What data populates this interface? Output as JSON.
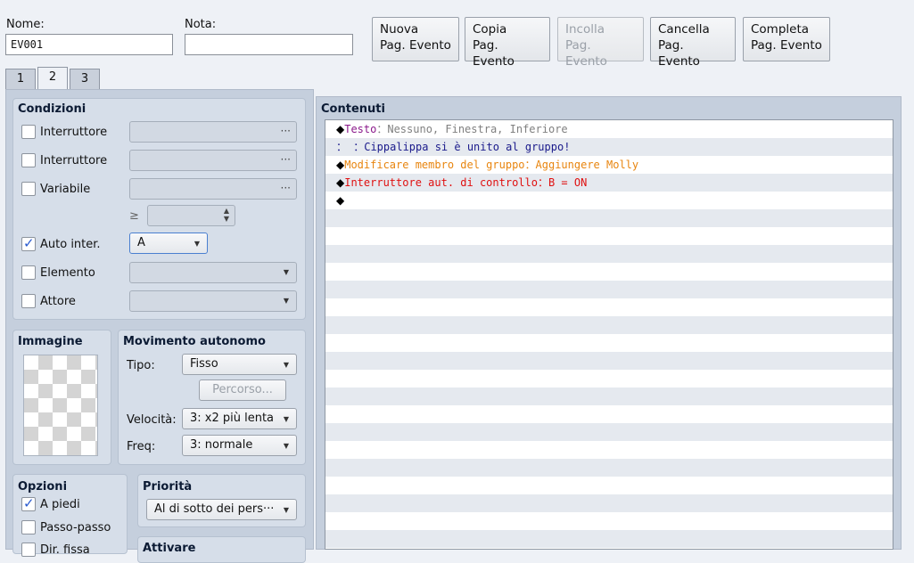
{
  "header": {
    "name_label": "Nome:",
    "name_value": "EV001",
    "note_label": "Nota:",
    "note_value": "",
    "buttons": [
      {
        "line1": "Nuova",
        "line2": "Pag. Evento",
        "enabled": true
      },
      {
        "line1": "Copia",
        "line2": "Pag. Evento",
        "enabled": true
      },
      {
        "line1": "Incolla",
        "line2": "Pag. Evento",
        "enabled": false
      },
      {
        "line1": "Cancella",
        "line2": "Pag. Evento",
        "enabled": true
      },
      {
        "line1": "Completa",
        "line2": "Pag. Evento",
        "enabled": true
      }
    ]
  },
  "tabs": [
    "1",
    "2",
    "3"
  ],
  "active_tab": "2",
  "conditions": {
    "title": "Condizioni",
    "switch1_label": "Interruttore",
    "switch2_label": "Interruttore",
    "variable_label": "Variabile",
    "ge_symbol": "≥",
    "self_switch_label": "Auto inter.",
    "self_switch_checked": true,
    "self_switch_value": "A",
    "item_label": "Elemento",
    "actor_label": "Attore",
    "dots": "···"
  },
  "image": {
    "title": "Immagine"
  },
  "movement": {
    "title": "Movimento autonomo",
    "type_label": "Tipo:",
    "type_value": "Fisso",
    "route_button": "Percorso...",
    "speed_label": "Velocità:",
    "speed_value": "3: x2 più lenta",
    "freq_label": "Freq:",
    "freq_value": "3: normale"
  },
  "options": {
    "title": "Opzioni",
    "walking": "A piedi",
    "walking_checked": true,
    "stepping": "Passo-passo",
    "direction_fix": "Dir. fissa"
  },
  "priority": {
    "title": "Priorità",
    "value": "Al di sotto dei pers···"
  },
  "trigger": {
    "title": "Attivare"
  },
  "contents": {
    "title": "Contenuti",
    "rows": [
      {
        "bullet": "◆",
        "parts": [
          {
            "text": "Testo",
            "color": "#8b1a8b"
          },
          {
            "text": "：Nessuno, Finestra, Inferiore",
            "color": "#808080"
          }
        ]
      },
      {
        "bullet": "",
        "parts": [
          {
            "text": "：     ：Cippalippa si è unito al gruppo!",
            "color": "#1a1a8b"
          }
        ]
      },
      {
        "bullet": "◆",
        "parts": [
          {
            "text": "Modificare membro del gruppo：Aggiungere Molly",
            "color": "#e8850f"
          }
        ]
      },
      {
        "bullet": "◆",
        "parts": [
          {
            "text": "Interruttore aut. di controllo：B = ON",
            "color": "#e01010"
          }
        ]
      },
      {
        "bullet": "◆",
        "parts": []
      }
    ]
  },
  "colors": {
    "background": "#eef1f6",
    "panel": "#c5cfdd",
    "group": "#d6dee9",
    "accent": "#2a5bd0"
  }
}
